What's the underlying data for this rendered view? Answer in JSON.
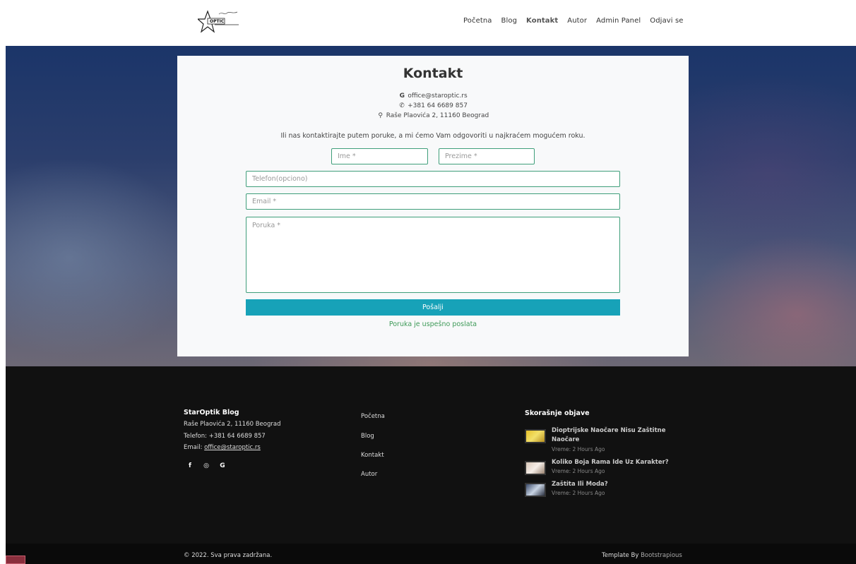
{
  "nav": {
    "items": [
      {
        "label": "Početna",
        "active": false
      },
      {
        "label": "Blog",
        "active": false
      },
      {
        "label": "Kontakt",
        "active": true
      },
      {
        "label": "Autor",
        "active": false
      },
      {
        "label": "Admin Panel",
        "active": false
      },
      {
        "label": "Odjavi se",
        "active": false
      }
    ]
  },
  "logo": {
    "text": "OPTIC"
  },
  "contact": {
    "title": "Kontakt",
    "email": "office@staroptic.rs",
    "phone": "+381 64 6689 857",
    "address": "Raše Plaovića 2, 11160 Beograd",
    "message": "Ili nas kontaktirajte putem poruke, a mi ćemo Vam odgovoriti u najkraćem mogućem roku.",
    "form": {
      "first_name_placeholder": "Ime *",
      "last_name_placeholder": "Prezime *",
      "phone_placeholder": "Telefon(opciono)",
      "email_placeholder": "Email *",
      "message_placeholder": "Poruka *",
      "submit_label": "Pošalji",
      "success_text": "Poruka je uspešno poslata"
    }
  },
  "footer": {
    "brand": "StarOptik Blog",
    "address": "Raše Plaovića 2, 11160 Beograd",
    "phone": "Telefon: +381 64 6689 857",
    "email_label": "Email: ",
    "email": "office@staroptic.rs",
    "social": [
      {
        "icon": "facebook-icon",
        "glyph": "f"
      },
      {
        "icon": "instagram-icon",
        "glyph": "◎"
      },
      {
        "icon": "google-icon",
        "glyph": "G"
      }
    ],
    "links": [
      "Početna",
      "Blog",
      "Kontakt",
      "Autor"
    ],
    "recent_title": "Skorašnje objave",
    "posts": [
      {
        "title": "Dioptrijske Naočare Nisu Zaštitne Naočare",
        "time": "Vreme: 2 Hours Ago"
      },
      {
        "title": "Koliko Boja Rama Ide Uz Karakter?",
        "time": "Vreme: 2 Hours Ago"
      },
      {
        "title": "Zaštita Ili Moda?",
        "time": "Vreme: 2 Hours Ago"
      }
    ]
  },
  "bottom": {
    "copyright": "© 2022. Sva prava zadržana.",
    "template_prefix": "Template By ",
    "template_link": "Bootstrapious"
  },
  "colors": {
    "accent": "#17a2b8",
    "field_border": "#3f9e7a",
    "success": "#3e9a58",
    "footer_bg": "#111111"
  }
}
